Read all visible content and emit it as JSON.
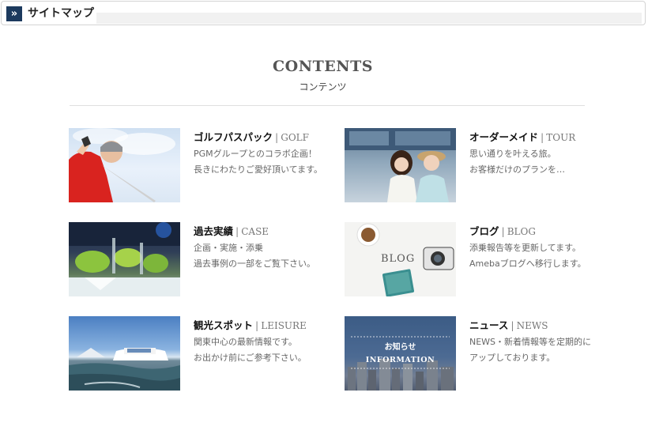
{
  "header": {
    "icon": "double-chevron-right-icon",
    "title": "サイトマップ"
  },
  "contents": {
    "title": "CONTENTS",
    "subtitle": "コンテンツ"
  },
  "cards": [
    {
      "title_jp": "ゴルフパスパック",
      "title_en": "GOLF",
      "desc1": "PGMグループとのコラボ企画！",
      "desc2": "長きにわたりご愛好頂いてます。"
    },
    {
      "title_jp": "オーダーメイド",
      "title_en": "TOUR",
      "desc1": "思い通りを叶える旅。",
      "desc2": "お客様だけのプランを…"
    },
    {
      "title_jp": "過去実績",
      "title_en": "CASE",
      "desc1": "企画・実施・添乗",
      "desc2": "過去事例の一部をご覧下さい。"
    },
    {
      "title_jp": "ブログ",
      "title_en": "BLOG",
      "desc1": "添乗報告等を更新してます。",
      "desc2": "Amebaブログへ移行します。"
    },
    {
      "title_jp": "観光スポット",
      "title_en": "LEISURE",
      "desc1": "関東中心の最新情報です。",
      "desc2": "お出かけ前にご参考下さい。"
    },
    {
      "title_jp": "ニュース",
      "title_en": "NEWS",
      "desc1": "NEWS・新着情報等を定期的に",
      "desc2": "アップしております。"
    }
  ],
  "thumb_text": {
    "blog": "BLOG",
    "news_jp": "お知らせ",
    "news_en": "INFORMATION"
  }
}
